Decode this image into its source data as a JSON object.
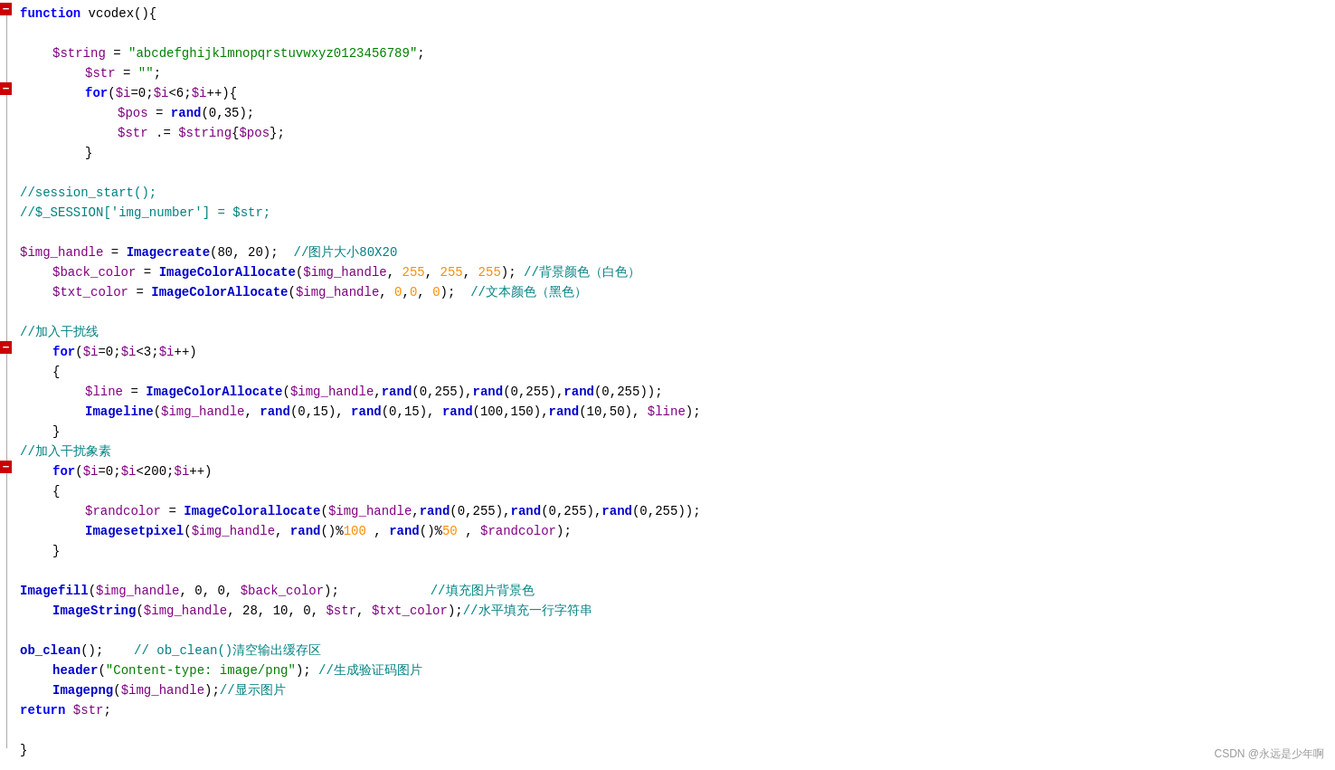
{
  "watermark": "CSDN @永远是少年啊",
  "code": {
    "lines": [
      {
        "id": 1,
        "indent": 0,
        "tokens": [
          {
            "t": "kw",
            "v": "function"
          },
          {
            "t": "plain",
            "v": " vcodex(){"
          }
        ],
        "fold": "open"
      },
      {
        "id": 2,
        "indent": 0,
        "tokens": []
      },
      {
        "id": 3,
        "indent": 1,
        "tokens": [
          {
            "t": "var",
            "v": "$string"
          },
          {
            "t": "plain",
            "v": " = "
          },
          {
            "t": "str",
            "v": "\"abcdefghijklmnopqrstuvwxyz0123456789\""
          },
          {
            "t": "plain",
            "v": ";"
          }
        ]
      },
      {
        "id": 4,
        "indent": 2,
        "tokens": [
          {
            "t": "var",
            "v": "$str"
          },
          {
            "t": "plain",
            "v": " = "
          },
          {
            "t": "str",
            "v": "\"\""
          },
          {
            "t": "plain",
            "v": ";"
          }
        ]
      },
      {
        "id": 5,
        "indent": 2,
        "tokens": [
          {
            "t": "kw",
            "v": "for"
          },
          {
            "t": "plain",
            "v": "("
          },
          {
            "t": "var",
            "v": "$i"
          },
          {
            "t": "plain",
            "v": "=0;"
          },
          {
            "t": "var",
            "v": "$i"
          },
          {
            "t": "plain",
            "v": "<6;"
          },
          {
            "t": "var",
            "v": "$i"
          },
          {
            "t": "plain",
            "v": "++){"
          }
        ],
        "fold": "open"
      },
      {
        "id": 6,
        "indent": 3,
        "tokens": [
          {
            "t": "var",
            "v": "$pos"
          },
          {
            "t": "plain",
            "v": " = "
          },
          {
            "t": "fn",
            "v": "rand"
          },
          {
            "t": "plain",
            "v": "(0,35);"
          }
        ]
      },
      {
        "id": 7,
        "indent": 3,
        "tokens": [
          {
            "t": "var",
            "v": "$str"
          },
          {
            "t": "plain",
            "v": " .= "
          },
          {
            "t": "var",
            "v": "$string"
          },
          {
            "t": "plain",
            "v": "{"
          },
          {
            "t": "var",
            "v": "$pos"
          },
          {
            "t": "plain",
            "v": "};"
          }
        ]
      },
      {
        "id": 8,
        "indent": 2,
        "tokens": [
          {
            "t": "plain",
            "v": "}"
          }
        ]
      },
      {
        "id": 9,
        "indent": 0,
        "tokens": []
      },
      {
        "id": 10,
        "indent": 0,
        "tokens": [
          {
            "t": "comment",
            "v": "//session_start();"
          }
        ]
      },
      {
        "id": 11,
        "indent": 0,
        "tokens": [
          {
            "t": "comment",
            "v": "//$_SESSION['img_number'] = $str;"
          }
        ]
      },
      {
        "id": 12,
        "indent": 0,
        "tokens": []
      },
      {
        "id": 13,
        "indent": 0,
        "tokens": [
          {
            "t": "var",
            "v": "$img_handle"
          },
          {
            "t": "plain",
            "v": " = "
          },
          {
            "t": "fn",
            "v": "Imagecreate"
          },
          {
            "t": "plain",
            "v": "(80, 20);  "
          },
          {
            "t": "comment",
            "v": "//图片大小80X20"
          }
        ]
      },
      {
        "id": 14,
        "indent": 1,
        "tokens": [
          {
            "t": "var",
            "v": "$back_color"
          },
          {
            "t": "plain",
            "v": " = "
          },
          {
            "t": "fn",
            "v": "ImageColorAllocate"
          },
          {
            "t": "plain",
            "v": "("
          },
          {
            "t": "var",
            "v": "$img_handle"
          },
          {
            "t": "plain",
            "v": ", "
          },
          {
            "t": "num",
            "v": "255"
          },
          {
            "t": "plain",
            "v": ", "
          },
          {
            "t": "num",
            "v": "255"
          },
          {
            "t": "plain",
            "v": ", "
          },
          {
            "t": "num",
            "v": "255"
          },
          {
            "t": "plain",
            "v": "); "
          },
          {
            "t": "comment",
            "v": "//背景颜色（白色）"
          }
        ]
      },
      {
        "id": 15,
        "indent": 1,
        "tokens": [
          {
            "t": "var",
            "v": "$txt_color"
          },
          {
            "t": "plain",
            "v": " = "
          },
          {
            "t": "fn",
            "v": "ImageColorAllocate"
          },
          {
            "t": "plain",
            "v": "("
          },
          {
            "t": "var",
            "v": "$img_handle"
          },
          {
            "t": "plain",
            "v": ", "
          },
          {
            "t": "num",
            "v": "0"
          },
          {
            "t": "plain",
            "v": ","
          },
          {
            "t": "num",
            "v": "0"
          },
          {
            "t": "plain",
            "v": ", "
          },
          {
            "t": "num",
            "v": "0"
          },
          {
            "t": "plain",
            "v": ");  "
          },
          {
            "t": "comment",
            "v": "//文本颜色（黑色）"
          }
        ]
      },
      {
        "id": 16,
        "indent": 0,
        "tokens": []
      },
      {
        "id": 17,
        "indent": 0,
        "tokens": [
          {
            "t": "comment",
            "v": "//加入干扰线"
          }
        ]
      },
      {
        "id": 18,
        "indent": 1,
        "tokens": [
          {
            "t": "kw",
            "v": "for"
          },
          {
            "t": "plain",
            "v": "("
          },
          {
            "t": "var",
            "v": "$i"
          },
          {
            "t": "plain",
            "v": "=0;"
          },
          {
            "t": "var",
            "v": "$i"
          },
          {
            "t": "plain",
            "v": "<3;"
          },
          {
            "t": "var",
            "v": "$i"
          },
          {
            "t": "plain",
            "v": "++)"
          }
        ],
        "fold": "open"
      },
      {
        "id": 19,
        "indent": 1,
        "tokens": [
          {
            "t": "plain",
            "v": "{"
          }
        ]
      },
      {
        "id": 20,
        "indent": 2,
        "tokens": [
          {
            "t": "var",
            "v": "$line"
          },
          {
            "t": "plain",
            "v": " = "
          },
          {
            "t": "fn",
            "v": "ImageColorAllocate"
          },
          {
            "t": "plain",
            "v": "("
          },
          {
            "t": "var",
            "v": "$img_handle"
          },
          {
            "t": "plain",
            "v": ","
          },
          {
            "t": "fn",
            "v": "rand"
          },
          {
            "t": "plain",
            "v": "(0,255),"
          },
          {
            "t": "fn",
            "v": "rand"
          },
          {
            "t": "plain",
            "v": "(0,255),"
          },
          {
            "t": "fn",
            "v": "rand"
          },
          {
            "t": "plain",
            "v": "(0,255));"
          }
        ]
      },
      {
        "id": 21,
        "indent": 2,
        "tokens": [
          {
            "t": "fn",
            "v": "Imageline"
          },
          {
            "t": "plain",
            "v": "("
          },
          {
            "t": "var",
            "v": "$img_handle"
          },
          {
            "t": "plain",
            "v": ", "
          },
          {
            "t": "fn",
            "v": "rand"
          },
          {
            "t": "plain",
            "v": "(0,15), "
          },
          {
            "t": "fn",
            "v": "rand"
          },
          {
            "t": "plain",
            "v": "(0,15), "
          },
          {
            "t": "fn",
            "v": "rand"
          },
          {
            "t": "plain",
            "v": "(100,150),"
          },
          {
            "t": "fn",
            "v": "rand"
          },
          {
            "t": "plain",
            "v": "(10,50), "
          },
          {
            "t": "var",
            "v": "$line"
          },
          {
            "t": "plain",
            "v": ");"
          }
        ]
      },
      {
        "id": 22,
        "indent": 1,
        "tokens": [
          {
            "t": "plain",
            "v": "}"
          }
        ]
      },
      {
        "id": 23,
        "indent": 0,
        "tokens": [
          {
            "t": "comment",
            "v": "//加入干扰象素"
          }
        ]
      },
      {
        "id": 24,
        "indent": 1,
        "tokens": [
          {
            "t": "kw",
            "v": "for"
          },
          {
            "t": "plain",
            "v": "("
          },
          {
            "t": "var",
            "v": "$i"
          },
          {
            "t": "plain",
            "v": "=0;"
          },
          {
            "t": "var",
            "v": "$i"
          },
          {
            "t": "plain",
            "v": "<200;"
          },
          {
            "t": "var",
            "v": "$i"
          },
          {
            "t": "plain",
            "v": "++)"
          }
        ],
        "fold": "open"
      },
      {
        "id": 25,
        "indent": 1,
        "tokens": [
          {
            "t": "plain",
            "v": "{"
          }
        ]
      },
      {
        "id": 26,
        "indent": 2,
        "tokens": [
          {
            "t": "var",
            "v": "$randcolor"
          },
          {
            "t": "plain",
            "v": " = "
          },
          {
            "t": "fn",
            "v": "ImageColorallocate"
          },
          {
            "t": "plain",
            "v": "("
          },
          {
            "t": "var",
            "v": "$img_handle"
          },
          {
            "t": "plain",
            "v": ","
          },
          {
            "t": "fn",
            "v": "rand"
          },
          {
            "t": "plain",
            "v": "(0,255),"
          },
          {
            "t": "fn",
            "v": "rand"
          },
          {
            "t": "plain",
            "v": "(0,255),"
          },
          {
            "t": "fn",
            "v": "rand"
          },
          {
            "t": "plain",
            "v": "(0,255));"
          }
        ]
      },
      {
        "id": 27,
        "indent": 2,
        "tokens": [
          {
            "t": "fn",
            "v": "Imagesetpixel"
          },
          {
            "t": "plain",
            "v": "("
          },
          {
            "t": "var",
            "v": "$img_handle"
          },
          {
            "t": "plain",
            "v": ", "
          },
          {
            "t": "fn",
            "v": "rand"
          },
          {
            "t": "plain",
            "v": "()%"
          },
          {
            "t": "num",
            "v": "100"
          },
          {
            "t": "plain",
            "v": " , "
          },
          {
            "t": "fn",
            "v": "rand"
          },
          {
            "t": "plain",
            "v": "()%"
          },
          {
            "t": "num",
            "v": "50"
          },
          {
            "t": "plain",
            "v": " , "
          },
          {
            "t": "var",
            "v": "$randcolor"
          },
          {
            "t": "plain",
            "v": ");"
          }
        ]
      },
      {
        "id": 28,
        "indent": 1,
        "tokens": [
          {
            "t": "plain",
            "v": "}"
          }
        ]
      },
      {
        "id": 29,
        "indent": 0,
        "tokens": []
      },
      {
        "id": 30,
        "indent": 0,
        "tokens": [
          {
            "t": "fn",
            "v": "Imagefill"
          },
          {
            "t": "plain",
            "v": "("
          },
          {
            "t": "var",
            "v": "$img_handle"
          },
          {
            "t": "plain",
            "v": ", 0, 0, "
          },
          {
            "t": "var",
            "v": "$back_color"
          },
          {
            "t": "plain",
            "v": ");            "
          },
          {
            "t": "comment",
            "v": "//填充图片背景色"
          }
        ]
      },
      {
        "id": 31,
        "indent": 1,
        "tokens": [
          {
            "t": "fn",
            "v": "ImageString"
          },
          {
            "t": "plain",
            "v": "("
          },
          {
            "t": "var",
            "v": "$img_handle"
          },
          {
            "t": "plain",
            "v": ", 28, 10, 0, "
          },
          {
            "t": "var",
            "v": "$str"
          },
          {
            "t": "plain",
            "v": ", "
          },
          {
            "t": "var",
            "v": "$txt_color"
          },
          {
            "t": "plain",
            "v": ");"
          },
          {
            "t": "comment",
            "v": "//水平填充一行字符串"
          }
        ]
      },
      {
        "id": 32,
        "indent": 0,
        "tokens": []
      },
      {
        "id": 33,
        "indent": 0,
        "tokens": [
          {
            "t": "fn",
            "v": "ob_clean"
          },
          {
            "t": "plain",
            "v": "();    "
          },
          {
            "t": "comment",
            "v": "// ob_clean()清空输出缓存区"
          }
        ]
      },
      {
        "id": 34,
        "indent": 1,
        "tokens": [
          {
            "t": "fn",
            "v": "header"
          },
          {
            "t": "plain",
            "v": "("
          },
          {
            "t": "str",
            "v": "\"Content-type: image/png\""
          },
          {
            "t": "plain",
            "v": "); "
          },
          {
            "t": "comment",
            "v": "//生成验证码图片"
          }
        ]
      },
      {
        "id": 35,
        "indent": 1,
        "tokens": [
          {
            "t": "fn",
            "v": "Imagepng"
          },
          {
            "t": "plain",
            "v": "("
          },
          {
            "t": "var",
            "v": "$img_handle"
          },
          {
            "t": "plain",
            "v": ");"
          },
          {
            "t": "comment",
            "v": "//显示图片"
          }
        ]
      },
      {
        "id": 36,
        "indent": 0,
        "tokens": [
          {
            "t": "kw",
            "v": "return"
          },
          {
            "t": "plain",
            "v": " "
          },
          {
            "t": "var",
            "v": "$str"
          },
          {
            "t": "plain",
            "v": ";"
          }
        ]
      },
      {
        "id": 37,
        "indent": 0,
        "tokens": []
      },
      {
        "id": 38,
        "indent": 0,
        "tokens": [
          {
            "t": "plain",
            "v": "}"
          }
        ]
      }
    ]
  }
}
